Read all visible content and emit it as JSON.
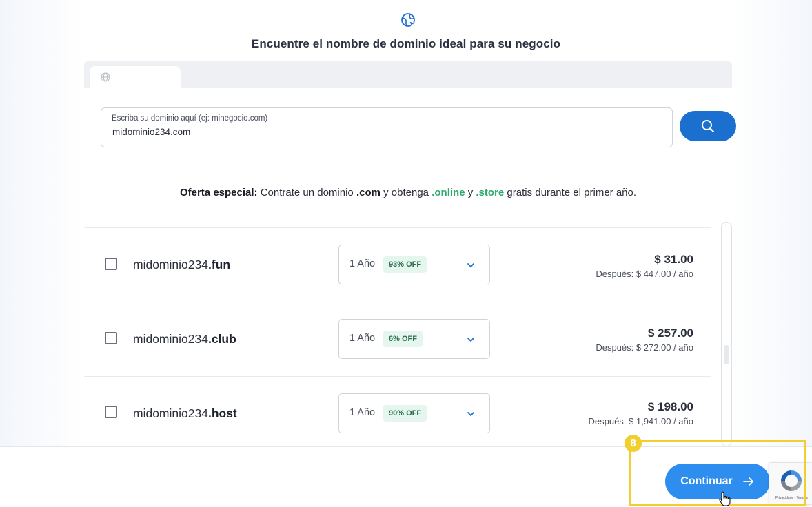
{
  "header": {
    "title": "Encuentre el nombre de dominio ideal para su negocio"
  },
  "search": {
    "label": "Escriba su dominio aquí (ej: minegocio.com)",
    "value": "midominio234.com"
  },
  "offer": {
    "prefix": "Oferta especial:",
    "text1": " Contrate un dominio ",
    "com": ".com",
    "text2": " y obtenga ",
    "online": ".online",
    "text3": " y ",
    "store": ".store",
    "text4": " gratis durante el primer año."
  },
  "domains": [
    {
      "base": "midominio234",
      "tld": ".fun",
      "period": "1 Año",
      "discount": "93% OFF",
      "price": "$ 31.00",
      "after": "Después: $ 447.00 / año",
      "checked": false
    },
    {
      "base": "midominio234",
      "tld": ".club",
      "period": "1 Año",
      "discount": "6% OFF",
      "price": "$ 257.00",
      "after": "Después: $ 272.00 / año",
      "checked": false
    },
    {
      "base": "midominio234",
      "tld": ".host",
      "period": "1 Año",
      "discount": "90% OFF",
      "price": "$ 198.00",
      "after": "Después: $ 1,941.00 / año",
      "checked": false
    }
  ],
  "footer": {
    "continue_label": "Continuar"
  },
  "recaptcha": {
    "text": "Privacidade - Termos"
  },
  "tutorial": {
    "step": "8"
  },
  "colors": {
    "primary": "#1b6fcf",
    "button": "#2d8ef0",
    "green": "#2eaa6e",
    "highlight": "#f0cf2e"
  }
}
